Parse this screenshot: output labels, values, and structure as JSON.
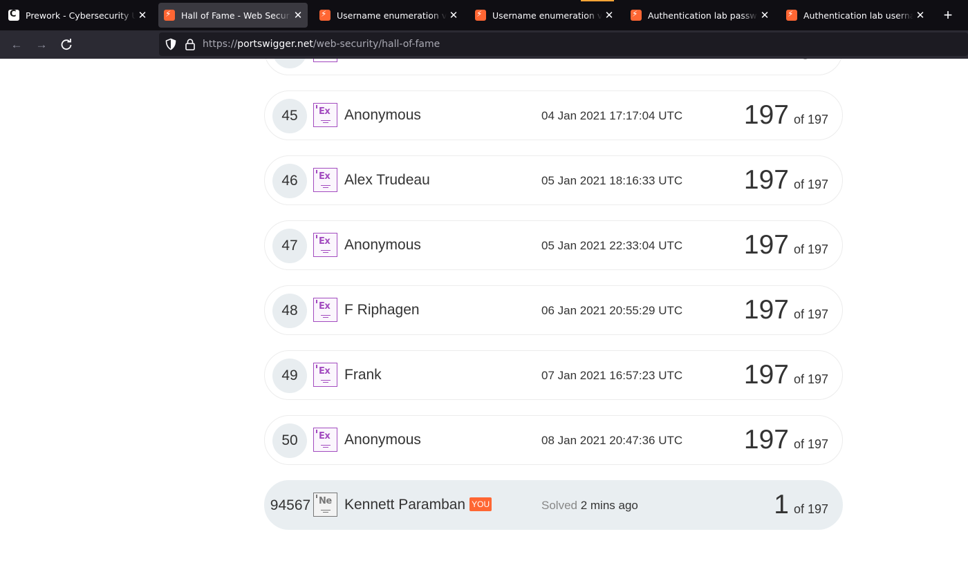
{
  "browser": {
    "tabs": [
      {
        "title": "Prework - Cybersecurity Univers",
        "icon": "cybersecurity-university-favicon",
        "active": false
      },
      {
        "title": "Hall of Fame - Web Security Aca",
        "icon": "portswigger-favicon",
        "active": true
      },
      {
        "title": "Username enumeration via diffe",
        "icon": "portswigger-favicon",
        "active": false
      },
      {
        "title": "Username enumeration via diffe",
        "icon": "portswigger-favicon",
        "active": false
      },
      {
        "title": "Authentication lab passwords | ",
        "icon": "portswigger-favicon",
        "active": false
      },
      {
        "title": "Authentication lab usernames | ",
        "icon": "portswigger-favicon",
        "active": false
      }
    ],
    "url": {
      "scheme": "https://",
      "host": "portswigger.net",
      "path": "/web-security/hall-of-fame"
    }
  },
  "leaderboard": {
    "rows": [
      {
        "rank": "45",
        "badge": "Ex",
        "name": "Anonymous",
        "date": "04 Jan 2021 17:17:04 UTC",
        "score": "197",
        "of": "of 197"
      },
      {
        "rank": "46",
        "badge": "Ex",
        "name": "Alex Trudeau",
        "date": "05 Jan 2021 18:16:33 UTC",
        "score": "197",
        "of": "of 197"
      },
      {
        "rank": "47",
        "badge": "Ex",
        "name": "Anonymous",
        "date": "05 Jan 2021 22:33:04 UTC",
        "score": "197",
        "of": "of 197"
      },
      {
        "rank": "48",
        "badge": "Ex",
        "name": "F Riphagen",
        "date": "06 Jan 2021 20:55:29 UTC",
        "score": "197",
        "of": "of 197"
      },
      {
        "rank": "49",
        "badge": "Ex",
        "name": "Frank",
        "date": "07 Jan 2021 16:57:23 UTC",
        "score": "197",
        "of": "of 197"
      },
      {
        "rank": "50",
        "badge": "Ex",
        "name": "Anonymous",
        "date": "08 Jan 2021 20:47:36 UTC",
        "score": "197",
        "of": "of 197"
      }
    ],
    "partial_top": {
      "score": "197"
    },
    "you": {
      "rank": "94567",
      "badge": "Ne",
      "name": "Kennett Paramban",
      "tag": "YOU",
      "solved_label": "Solved",
      "solved_time": "2 mins ago",
      "score": "1",
      "of": "of 197"
    }
  },
  "colors": {
    "accent": "#ff6633",
    "expert_badge": "#a24bbf",
    "tab_indicator": "#ffa436"
  }
}
